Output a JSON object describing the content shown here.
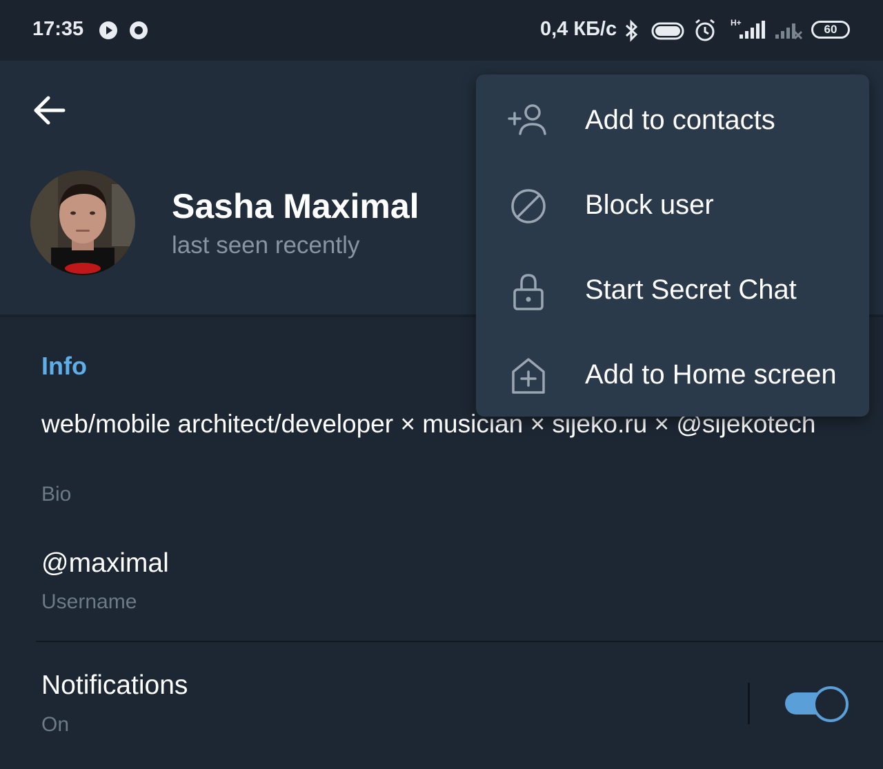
{
  "status_bar": {
    "time": "17:35",
    "network_speed": "0,4 КБ/с",
    "signal_label": "H+",
    "battery": "60",
    "icons": [
      "play-circle-icon",
      "record-circle-icon",
      "bluetooth-icon",
      "toggle-icon",
      "alarm-icon",
      "signal-icon",
      "signal-weak-icon",
      "battery-icon"
    ]
  },
  "header": {
    "back_icon": "arrow-left-icon",
    "name": "Sasha Maximal",
    "status": "last seen recently"
  },
  "menu": {
    "items": [
      {
        "label": "Add to contacts",
        "icon": "add-user-icon"
      },
      {
        "label": "Block user",
        "icon": "block-icon"
      },
      {
        "label": "Start Secret Chat",
        "icon": "lock-icon"
      },
      {
        "label": "Add to Home screen",
        "icon": "add-home-icon"
      }
    ]
  },
  "info": {
    "title": "Info",
    "bio": "web/mobile architect/developer × musician × sijeko.ru × @sijekotech",
    "bio_label": "Bio",
    "username": "@maximal",
    "username_label": "Username"
  },
  "notifications": {
    "title": "Notifications",
    "status": "On",
    "enabled": true
  },
  "colors": {
    "background": "#1d2733",
    "header": "#212d3b",
    "menu": "#2b3a4b",
    "accent": "#5eaee9",
    "muted": "#6d7a88"
  }
}
